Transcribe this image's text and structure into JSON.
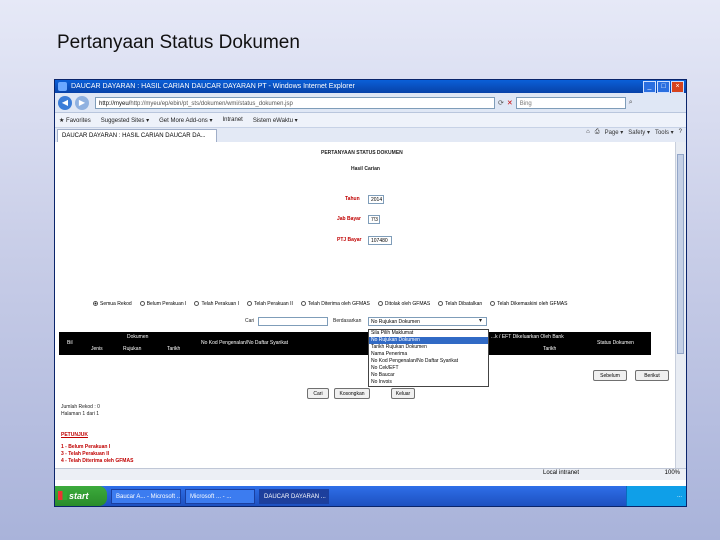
{
  "slide": {
    "title": "Pertanyaan Status Dokumen"
  },
  "window": {
    "title": "DAUCAR DAYARAN : HASIL CARIAN DAUCAR DAYARAN PT - Windows Internet Explorer",
    "address": "http://myeu/ep/ebin/pt_sts/dokumen/wmi/status_dokumen.jsp",
    "address_host": "http://myeu/",
    "search_placeholder": "Bing",
    "tab_label": "DAUCAR DAYARAN : HASIL CARIAN DAUCAR DA...",
    "favorites_label": "Favorites",
    "fav_items": [
      "Suggested Sites ▾",
      "Get More Add-ons ▾",
      "Intranet",
      "Sistem eWaktu ▾"
    ],
    "tools": [
      "Page ▾",
      "Safety ▾",
      "Tools ▾",
      "?"
    ]
  },
  "page": {
    "heading": "PERTANYAAN STATUS DOKUMEN",
    "subheading": "Hasil Carian",
    "tahun_label": "Tahun",
    "tahun_value": "2014",
    "jab_label": "Jab Bayar",
    "jab_value": "7!3",
    "ptj_label": "PTJ Bayar",
    "ptj_value": "107480",
    "radio_options": [
      "Semua Rekod",
      "Belum Perakuan I",
      "Telah Perakuan I",
      "Telah Perakuan II",
      "Telah Diterima oleh GFMAS",
      "Ditolak oleh GFMAS",
      "Telah Dibatalkan",
      "Telah Dikemaskini oleh GFMAS"
    ],
    "cari_label": "Cari",
    "berdasarkan_label": "Berdasarkan",
    "berdasarkan_value": "No Rujukan Dokumen",
    "dropdown_options": [
      "Sila Pilih Maklumat",
      "No Rujukan Dokumen",
      "Tarikh Rujukan Dokumen",
      "Nama Penerima",
      "No Kod Pengenalan/No Daftar Syarikat",
      "No Cek/EFT",
      "No Baucar",
      "No Invois"
    ],
    "table": {
      "no": "Bil",
      "dokumen": "Dokumen",
      "jenis": "Jenis",
      "rujukan": "Rujukan",
      "tarikh": "Tarikh",
      "kod": "No Kod Pengenalan/No Daftar Syarikat",
      "bank": "...k / EFT Dikeluarkan Oleh Bank",
      "tarikh2": "Tarikh",
      "status": "Status Dokumen"
    },
    "btn_cari": "Cari",
    "btn_kosongkan": "Kosongkan",
    "btn_keluar": "Keluar",
    "btn_sebelum": "Sebelum",
    "btn_berikut": "Berikut",
    "jumlah": "Jumlah Rekod : 0",
    "halaman": "Halaman 1 dari 1",
    "petunjuk_title": "PETUNJUK",
    "petunjuk_items": [
      "1 - Belum Perakuan I",
      "3 - Telah Perakuan II",
      "4 - Telah Diterima oleh GFMAS"
    ]
  },
  "statusbar": {
    "zone": "Local intranet",
    "zoom": "100%"
  },
  "taskbar": {
    "start": "start",
    "items": [
      "Baucar A... - Microsoft ...",
      "Microsoft ... - ...",
      "DAUCAR DAYARAN ..."
    ],
    "clock": "..."
  }
}
